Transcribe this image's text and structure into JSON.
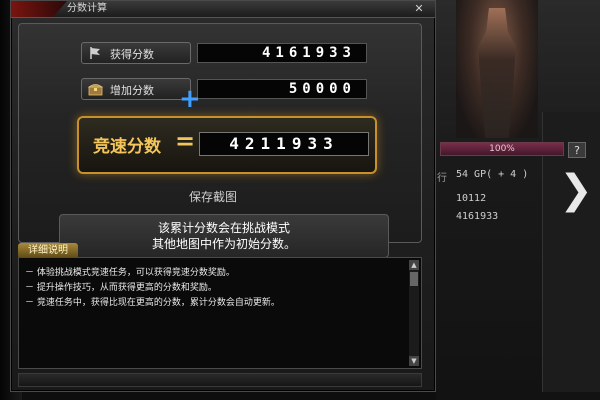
{
  "dialog": {
    "title": "分数计算",
    "close_label": "✕",
    "rows": [
      {
        "label": "获得分数",
        "value": "4161933"
      },
      {
        "label": "增加分数",
        "value": "50000"
      }
    ],
    "plus_symbol": "+",
    "result": {
      "label": "竞速分数",
      "equals": "=",
      "value": "4211933"
    },
    "save_label": "保存截图",
    "notice_line1": "该累计分数会在挑战模式",
    "notice_line2": "其他地图中作为初始分数。"
  },
  "details": {
    "tab_label": "详细说明",
    "lines": [
      "－ 体验挑战模式竞速任务，可以获得竞速分数奖励。",
      "－ 提升操作技巧，从而获得更高的分数和奖励。",
      "－ 竞速任务中，获得比现在更高的分数，累计分数会自动更新。"
    ],
    "scroll_up": "▲",
    "scroll_down": "▼"
  },
  "side": {
    "hp_label": "100%",
    "help_label": "?",
    "stat_prefix": "行",
    "stats": [
      "54 GP( + 4 )",
      "10112",
      "4161933"
    ],
    "next_arrow": "❯"
  }
}
